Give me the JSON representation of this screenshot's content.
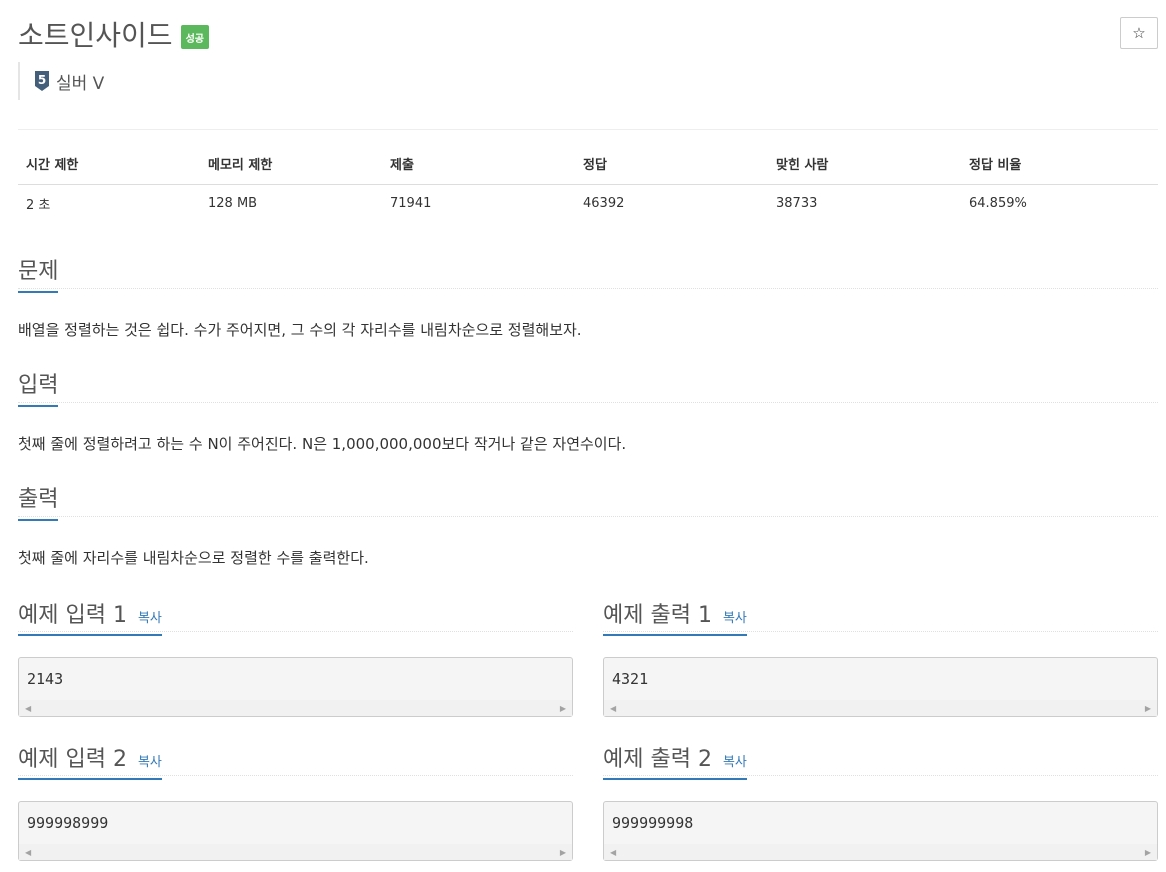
{
  "problem": {
    "title": "소트인사이드",
    "status_badge": "성공",
    "star_icon": "☆",
    "tier": {
      "label": "실버 V",
      "level": "5",
      "color": "#435f7a"
    }
  },
  "stats": {
    "headers": [
      "시간 제한",
      "메모리 제한",
      "제출",
      "정답",
      "맞힌 사람",
      "정답 비율"
    ],
    "values": [
      "2 초",
      "128 MB",
      "71941",
      "46392",
      "38733",
      "64.859%"
    ]
  },
  "sections": {
    "problem": {
      "heading": "문제",
      "text": "배열을 정렬하는 것은 쉽다. 수가 주어지면, 그 수의 각 자리수를 내림차순으로 정렬해보자."
    },
    "input": {
      "heading": "입력",
      "text": "첫째 줄에 정렬하려고 하는 수 N이 주어진다. N은 1,000,000,000보다 작거나 같은 자연수이다."
    },
    "output": {
      "heading": "출력",
      "text": "첫째 줄에 자리수를 내림차순으로 정렬한 수를 출력한다."
    }
  },
  "samples": [
    {
      "input_heading": "예제 입력 1",
      "input_value": "2143",
      "output_heading": "예제 출력 1",
      "output_value": "4321"
    },
    {
      "input_heading": "예제 입력 2",
      "input_value": "999998999",
      "output_heading": "예제 출력 2",
      "output_value": "999999998"
    }
  ],
  "copy_label": "복사",
  "colors": {
    "accent": "#337ab7",
    "success": "#5cb85c"
  }
}
